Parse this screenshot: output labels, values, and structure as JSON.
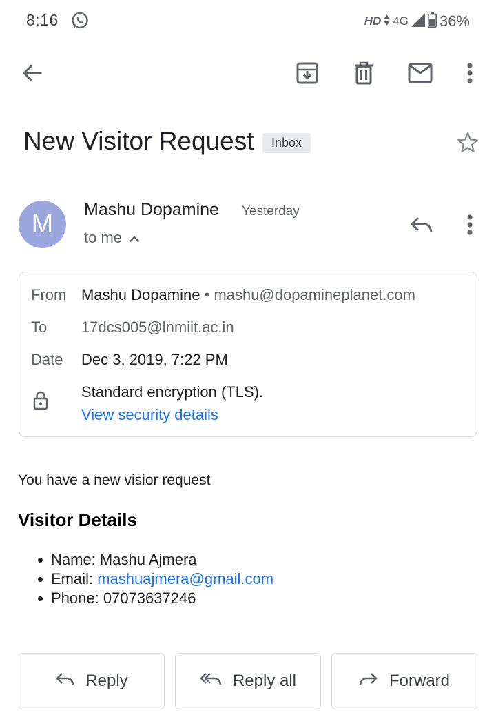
{
  "status_bar": {
    "time": "8:16",
    "network_hd": "HD",
    "network_type": "4G",
    "battery": "36%"
  },
  "toolbar": {
    "icons": [
      "back-arrow-icon",
      "archive-icon",
      "delete-icon",
      "mark-unread-icon",
      "more-vert-icon"
    ]
  },
  "email": {
    "subject": "New Visitor Request",
    "label": "Inbox",
    "sender": {
      "initial": "M",
      "name": "Mashu Dopamine",
      "time": "Yesterday",
      "to_line": "to me"
    },
    "details": {
      "from_label": "From",
      "from_name": "Mashu Dopamine",
      "from_sep": "•",
      "from_email": "mashu@dopamineplanet.com",
      "to_label": "To",
      "to_value": "17dcs005@lnmiit.ac.in",
      "date_label": "Date",
      "date_value": "Dec 3, 2019, 7:22 PM",
      "encryption": "Standard encryption (TLS).",
      "security_link": "View security details"
    },
    "body": {
      "intro": "You have a new visior request",
      "heading": "Visitor Details",
      "name_label": "Name: ",
      "name_value": "Mashu Ajmera",
      "email_label": "Email: ",
      "email_value": "mashuajmera@gmail.com",
      "phone_label": "Phone: ",
      "phone_value": "07073637246"
    }
  },
  "actions": {
    "reply": "Reply",
    "reply_all": "Reply all",
    "forward": "Forward"
  },
  "colors": {
    "avatar": "#9aa6dc",
    "link": "#1a73e8",
    "chip": "#e8eaed",
    "icon": "#5f6368"
  }
}
